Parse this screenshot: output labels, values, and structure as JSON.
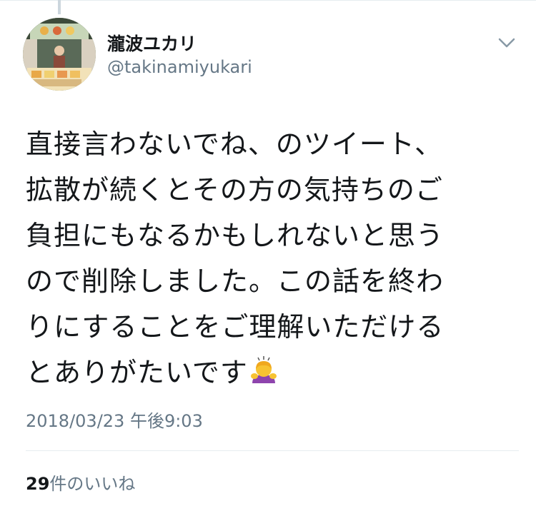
{
  "author": {
    "display_name": "瀧波ユカリ",
    "handle": "@takinamiyukari"
  },
  "tweet": {
    "lines": [
      "直接言わないでね、のツイート、",
      "拡散が続くとその方の気持ちのご",
      "負担にもなるかもしれないと思う",
      "ので削除しました。この話を終わ",
      "りにすることをご理解いただける",
      "とありがたいです"
    ],
    "emoji": "person-bowing-emoji",
    "timestamp": "2018/03/23 午後9:03"
  },
  "stats": {
    "likes_count": "29",
    "likes_label": "件のいいね"
  },
  "icons": {
    "menu": "chevron-down-icon"
  },
  "colors": {
    "text": "#14171a",
    "secondary": "#657786",
    "border": "#e6ecf0"
  }
}
